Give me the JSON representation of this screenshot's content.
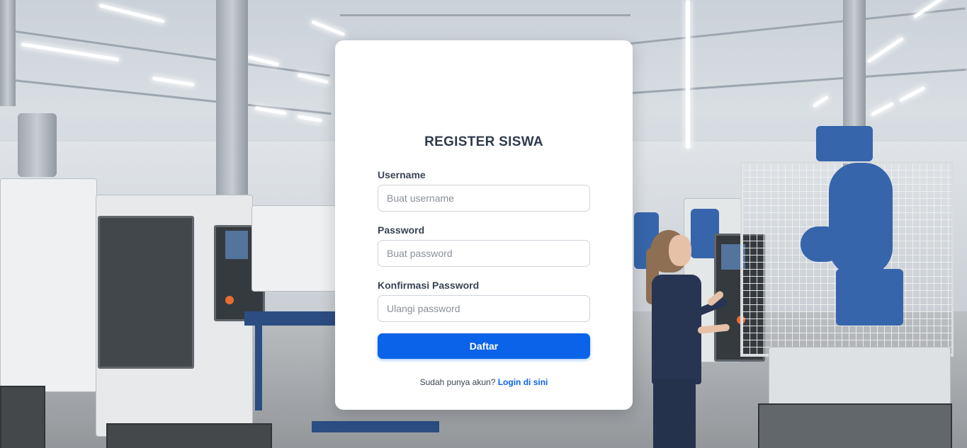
{
  "form": {
    "title": "REGISTER SISWA",
    "username_label": "Username",
    "username_placeholder": "Buat username",
    "password_label": "Password",
    "password_placeholder": "Buat password",
    "confirm_label": "Konfirmasi Password",
    "confirm_placeholder": "Ulangi password",
    "submit_label": "Daftar",
    "footer_text": "Sudah punya akun?",
    "login_link_label": "Login di sini"
  },
  "colors": {
    "primary": "#0a63e9",
    "card_bg": "#ffffff",
    "title_text": "#2f3b4c"
  },
  "background": {
    "description_icon": "factory-background-image"
  }
}
